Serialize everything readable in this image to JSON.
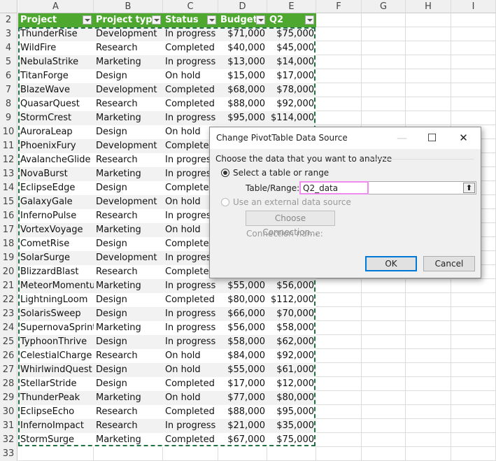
{
  "columns": [
    "A",
    "B",
    "C",
    "D",
    "E",
    "F",
    "G",
    "H",
    "I"
  ],
  "table": {
    "header_row": 2,
    "headers": [
      "Project",
      "Project type",
      "Status",
      "Budget",
      "Q2"
    ],
    "rows": [
      {
        "n": 3,
        "cells": [
          "ThunderRise",
          "Development",
          "In progress",
          "$71,000",
          "$75,000"
        ]
      },
      {
        "n": 4,
        "cells": [
          "WildFire",
          "Research",
          "Completed",
          "$40,000",
          "$45,000"
        ]
      },
      {
        "n": 5,
        "cells": [
          "NebulaStrike",
          "Marketing",
          "In progress",
          "$13,000",
          "$14,000"
        ]
      },
      {
        "n": 6,
        "cells": [
          "TitanForge",
          "Design",
          "On hold",
          "$15,000",
          "$17,000"
        ]
      },
      {
        "n": 7,
        "cells": [
          "BlazeWave",
          "Development",
          "Completed",
          "$68,000",
          "$78,000"
        ]
      },
      {
        "n": 8,
        "cells": [
          "QuasarQuest",
          "Research",
          "Completed",
          "$88,000",
          "$92,000"
        ]
      },
      {
        "n": 9,
        "cells": [
          "StormCrest",
          "Marketing",
          "In progress",
          "$95,000",
          "$114,000"
        ]
      },
      {
        "n": 10,
        "cells": [
          "AuroraLeap",
          "Design",
          "On hold",
          "",
          ""
        ]
      },
      {
        "n": 11,
        "cells": [
          "PhoenixFury",
          "Development",
          "Completed",
          "",
          ""
        ]
      },
      {
        "n": 12,
        "cells": [
          "AvalancheGlide",
          "Research",
          "In progress",
          "",
          ""
        ]
      },
      {
        "n": 13,
        "cells": [
          "NovaBurst",
          "Marketing",
          "In progress",
          "",
          ""
        ]
      },
      {
        "n": 14,
        "cells": [
          "EclipseEdge",
          "Design",
          "Completed",
          "",
          ""
        ]
      },
      {
        "n": 15,
        "cells": [
          "GalaxyGale",
          "Development",
          "On hold",
          "",
          ""
        ]
      },
      {
        "n": 16,
        "cells": [
          "InfernoPulse",
          "Research",
          "In progress",
          "",
          ""
        ]
      },
      {
        "n": 17,
        "cells": [
          "VortexVoyage",
          "Marketing",
          "On hold",
          "",
          ""
        ]
      },
      {
        "n": 18,
        "cells": [
          "CometRise",
          "Design",
          "Completed",
          "",
          ""
        ]
      },
      {
        "n": 19,
        "cells": [
          "SolarSurge",
          "Development",
          "In progress",
          "",
          ""
        ]
      },
      {
        "n": 20,
        "cells": [
          "BlizzardBlast",
          "Research",
          "Completed",
          "",
          ""
        ]
      },
      {
        "n": 21,
        "cells": [
          "MeteorMomentu",
          "Marketing",
          "In progress",
          "$55,000",
          "$56,000"
        ]
      },
      {
        "n": 22,
        "cells": [
          "LightningLoom",
          "Design",
          "Completed",
          "$80,000",
          "$112,000"
        ]
      },
      {
        "n": 23,
        "cells": [
          "SolarisSweep",
          "Design",
          "In progress",
          "$66,000",
          "$70,000"
        ]
      },
      {
        "n": 24,
        "cells": [
          "SupernovaSprint",
          "Marketing",
          "In progress",
          "$56,000",
          "$58,000"
        ]
      },
      {
        "n": 25,
        "cells": [
          "TyphoonThrive",
          "Design",
          "In progress",
          "$58,000",
          "$62,000"
        ]
      },
      {
        "n": 26,
        "cells": [
          "CelestialCharge",
          "Research",
          "On hold",
          "$84,000",
          "$92,000"
        ]
      },
      {
        "n": 27,
        "cells": [
          "WhirlwindQuest",
          "Design",
          "On hold",
          "$55,000",
          "$61,000"
        ]
      },
      {
        "n": 28,
        "cells": [
          "StellarStride",
          "Design",
          "Completed",
          "$17,000",
          "$12,000"
        ]
      },
      {
        "n": 29,
        "cells": [
          "ThunderPeak",
          "Marketing",
          "On hold",
          "$77,000",
          "$80,000"
        ]
      },
      {
        "n": 30,
        "cells": [
          "EclipseEcho",
          "Research",
          "Completed",
          "$88,000",
          "$95,000"
        ]
      },
      {
        "n": 31,
        "cells": [
          "InfernoImpact",
          "Research",
          "In progress",
          "$21,000",
          "$35,000"
        ]
      },
      {
        "n": 32,
        "cells": [
          "StormSurge",
          "Marketing",
          "Completed",
          "$67,000",
          "$75,000"
        ]
      }
    ],
    "empty_rows": [
      33
    ],
    "header_color": "#4ea72e",
    "band_color": "#f2f2f2"
  },
  "dialog": {
    "title": "Change PivotTable Data Source",
    "minimize": "—",
    "maximize": "☐",
    "close": "✕",
    "section_label": "Choose the data that you want to analyze",
    "option_table": "Select a table or range",
    "table_range_label": "Table/Range:",
    "table_range_value": "Q2_data",
    "collapse_icon": "⬆",
    "option_external": "Use an external data source",
    "choose_connection": "Choose Connection...",
    "connection_name_label": "Connection name:",
    "ok": "OK",
    "cancel": "Cancel"
  }
}
